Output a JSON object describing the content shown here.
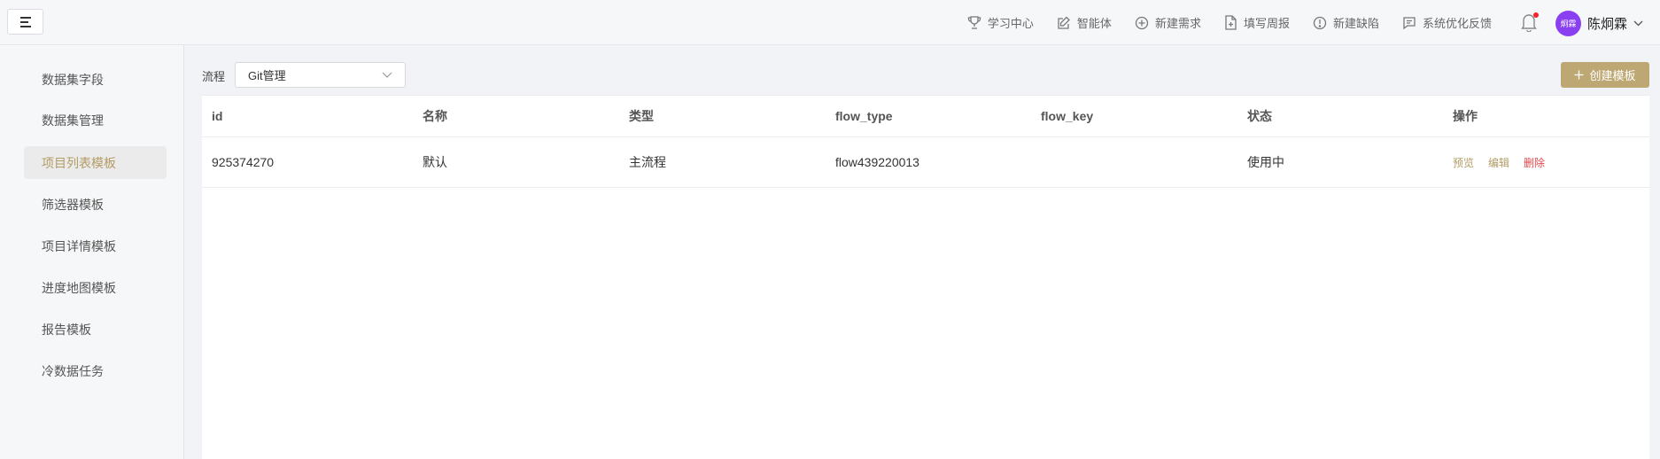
{
  "header": {
    "actions": [
      {
        "label": "学习中心",
        "icon": "trophy-icon"
      },
      {
        "label": "智能体",
        "icon": "edit-icon"
      },
      {
        "label": "新建需求",
        "icon": "plus-circle-icon"
      },
      {
        "label": "填写周报",
        "icon": "file-add-icon"
      },
      {
        "label": "新建缺陷",
        "icon": "exclamation-circle-icon"
      },
      {
        "label": "系统优化反馈",
        "icon": "message-icon"
      }
    ],
    "user": {
      "avatar_text": "炯霖",
      "name": "陈炯霖"
    }
  },
  "sidebar": {
    "items": [
      {
        "label": "数据集字段",
        "active": false
      },
      {
        "label": "数据集管理",
        "active": false
      },
      {
        "label": "项目列表模板",
        "active": true
      },
      {
        "label": "筛选器模板",
        "active": false
      },
      {
        "label": "项目详情模板",
        "active": false
      },
      {
        "label": "进度地图模板",
        "active": false
      },
      {
        "label": "报告模板",
        "active": false
      },
      {
        "label": "冷数据任务",
        "active": false
      }
    ]
  },
  "toolbar": {
    "flow_label": "流程",
    "flow_value": "Git管理",
    "create_label": "创建模板"
  },
  "table": {
    "columns": [
      "id",
      "名称",
      "类型",
      "flow_type",
      "flow_key",
      "状态",
      "操作"
    ],
    "rows": [
      {
        "id": "925374270",
        "name": "默认",
        "type": "主流程",
        "flow_type": "flow439220013",
        "flow_key": "",
        "status": "使用中",
        "ops": {
          "preview": "预览",
          "edit": "编辑",
          "delete": "删除"
        }
      }
    ]
  },
  "colors": {
    "accent": "#bda874",
    "accent_text": "#b39b64",
    "danger": "#e5484d",
    "avatar_bg": "#8a3ff0"
  }
}
